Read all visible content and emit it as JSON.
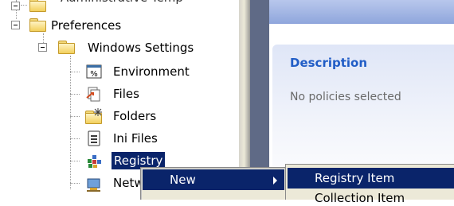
{
  "tree": {
    "truncated_label": "Administrative Temp",
    "preferences": "Preferences",
    "windows_settings": "Windows Settings",
    "items": [
      {
        "label": "Environment",
        "icon": "environment-icon"
      },
      {
        "label": "Files",
        "icon": "files-icon"
      },
      {
        "label": "Folders",
        "icon": "folders-icon"
      },
      {
        "label": "Ini Files",
        "icon": "ini-files-icon"
      },
      {
        "label": "Registry",
        "icon": "registry-icon",
        "selected": true
      },
      {
        "label": "Network Shares",
        "icon": "network-shares-icon"
      }
    ]
  },
  "details": {
    "title": "Description",
    "text": "No policies selected"
  },
  "context_menu": {
    "new_label": "New",
    "submenu": [
      "Registry Item",
      "Collection Item"
    ]
  },
  "colors": {
    "selection": "#0a246a",
    "menu_bg": "#ece9d8",
    "desc_title": "#215dc6"
  }
}
